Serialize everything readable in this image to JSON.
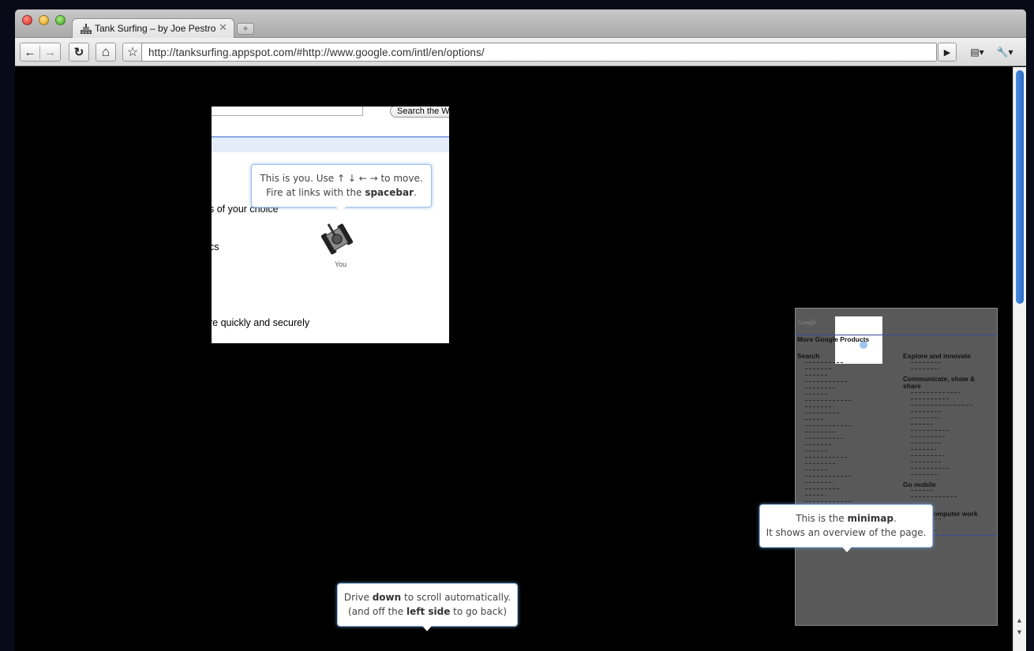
{
  "browser": {
    "tab_title": "Tank Surfing – by Joe Pestro",
    "tab_close": "✕",
    "new_tab": "+",
    "url": "http://tanksurfing.appspot.com/#http://www.google.com/intl/en/options/",
    "icons": {
      "back": "←",
      "forward": "→",
      "reload": "↻",
      "home": "⌂",
      "star": "☆",
      "go": "▶",
      "page": "▤▾",
      "wrench": "🔧▾"
    }
  },
  "page": {
    "search_button": "Search the W",
    "line1": "s of your choice",
    "line2": "cs",
    "line3": "re quickly and securely",
    "you_label": "You"
  },
  "bubbles": {
    "you": {
      "l1a": "This is you. Use ↑ ↓ ← → to move.",
      "l2a": "Fire at links with the ",
      "l2b": "spacebar",
      "l2c": "."
    },
    "drive": {
      "l1a": "Drive ",
      "l1b": "down",
      "l1c": " to scroll automatically.",
      "l2a": "(and off the ",
      "l2b": "left side",
      "l2c": " to go back)"
    },
    "minimap": {
      "l1a": "This is the ",
      "l1b": "minimap",
      "l1c": ".",
      "l2": "It shows an overview of the page."
    }
  },
  "minimap": {
    "logo": "Google",
    "title": "More Google Products",
    "col_left_heading": "Search",
    "col_right_h1": "Explore and innovate",
    "col_right_h2": "Communicate, show & share",
    "col_right_h3": "Go mobile",
    "col_right_h4": "r computer work"
  },
  "colors": {
    "accent": "#4a8ee0",
    "bubble_border": "#9fc2e6",
    "minimap_bg": "#595959"
  }
}
